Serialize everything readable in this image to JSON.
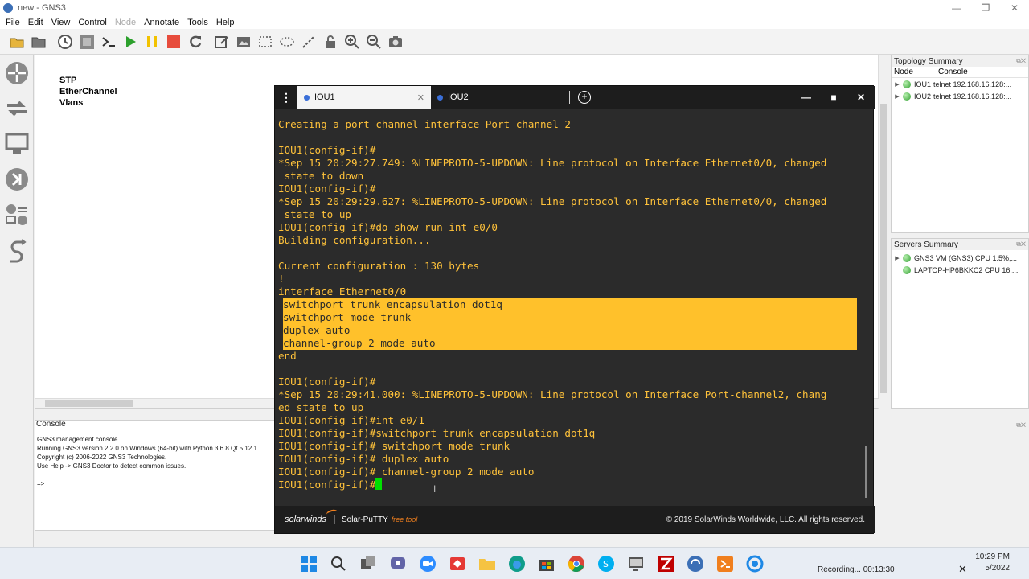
{
  "window": {
    "title": "new - GNS3",
    "controls": [
      "—",
      "❐",
      "✕"
    ]
  },
  "menu": {
    "items": [
      {
        "label": "File",
        "enabled": true
      },
      {
        "label": "Edit",
        "enabled": true
      },
      {
        "label": "View",
        "enabled": true
      },
      {
        "label": "Control",
        "enabled": true
      },
      {
        "label": "Node",
        "enabled": false
      },
      {
        "label": "Annotate",
        "enabled": true
      },
      {
        "label": "Tools",
        "enabled": true
      },
      {
        "label": "Help",
        "enabled": true
      }
    ]
  },
  "toolbar": {
    "icons": [
      "open-folder-icon",
      "folder-icon",
      "clock-icon",
      "snapshot-icon",
      "console-icon",
      "start-icon",
      "suspend-icon",
      "stop-icon",
      "reload-icon",
      "edit-note-icon",
      "insert-picture-icon",
      "rectangle-icon",
      "ellipse-icon",
      "line-icon",
      "lock-icon",
      "zoom-in-icon",
      "zoom-out-icon",
      "screenshot-icon"
    ],
    "colors": {
      "start": "#2ca02c",
      "suspend": "#f2c200",
      "stop": "#e74c3c"
    }
  },
  "canvas": {
    "note_lines": [
      "STP",
      "EtherChannel",
      "Vlans"
    ]
  },
  "topology_summary": {
    "title": "Topology Summary",
    "columns": [
      "Node",
      "Console"
    ],
    "rows": [
      {
        "node": "IOU1",
        "console": "telnet 192.168.16.128:..."
      },
      {
        "node": "IOU2",
        "console": "telnet 192.168.16.128:..."
      }
    ]
  },
  "servers_summary": {
    "title": "Servers Summary",
    "rows": [
      {
        "label": "GNS3 VM (GNS3) CPU 1.5%,..."
      },
      {
        "label": "LAPTOP-HP6BKKC2 CPU 16...."
      }
    ]
  },
  "console": {
    "title": "Console",
    "lines": [
      "GNS3 management console.",
      "Running GNS3 version 2.2.0 on Windows (64-bit) with Python 3.6.8 Qt 5.12.1",
      "Copyright (c) 2006-2022 GNS3 Technologies.",
      "Use Help -> GNS3 Doctor to detect common issues.",
      "",
      "=>"
    ]
  },
  "putty": {
    "tabs": [
      {
        "label": "IOU1",
        "active": true
      },
      {
        "label": "IOU2",
        "active": false
      }
    ],
    "terminal_lines": [
      {
        "text": "Creating a port-channel interface Port-channel 2",
        "hl": false
      },
      {
        "text": "",
        "hl": false
      },
      {
        "text": "IOU1(config-if)#",
        "hl": false
      },
      {
        "text": "*Sep 15 20:29:27.749: %LINEPROTO-5-UPDOWN: Line protocol on Interface Ethernet0/0, changed",
        "hl": false
      },
      {
        "text": " state to down",
        "hl": false
      },
      {
        "text": "IOU1(config-if)#",
        "hl": false
      },
      {
        "text": "*Sep 15 20:29:29.627: %LINEPROTO-5-UPDOWN: Line protocol on Interface Ethernet0/0, changed",
        "hl": false
      },
      {
        "text": " state to up",
        "hl": false
      },
      {
        "text": "IOU1(config-if)#do show run int e0/0",
        "hl": false
      },
      {
        "text": "Building configuration...",
        "hl": false
      },
      {
        "text": "",
        "hl": false
      },
      {
        "text": "Current configuration : 130 bytes",
        "hl": false
      },
      {
        "text": "!",
        "hl": false
      },
      {
        "text": "interface Ethernet0/0",
        "hl": false
      },
      {
        "text": "switchport trunk encapsulation dot1q",
        "hl": true
      },
      {
        "text": "switchport mode trunk",
        "hl": true
      },
      {
        "text": "duplex auto",
        "hl": true
      },
      {
        "text": "channel-group 2 mode auto",
        "hl": true
      },
      {
        "text": "end",
        "hl": false
      },
      {
        "text": "",
        "hl": false
      },
      {
        "text": "IOU1(config-if)#",
        "hl": false
      },
      {
        "text": "*Sep 15 20:29:41.000: %LINEPROTO-5-UPDOWN: Line protocol on Interface Port-channel2, chang",
        "hl": false
      },
      {
        "text": "ed state to up",
        "hl": false
      },
      {
        "text": "IOU1(config-if)#int e0/1",
        "hl": false
      },
      {
        "text": "IOU1(config-if)#switchport trunk encapsulation dot1q",
        "hl": false
      },
      {
        "text": "IOU1(config-if)# switchport mode trunk",
        "hl": false
      },
      {
        "text": "IOU1(config-if)# duplex auto",
        "hl": false
      },
      {
        "text": "IOU1(config-if)# channel-group 2 mode auto",
        "hl": false
      }
    ],
    "prompt": "IOU1(config-if)#",
    "footer": {
      "logo": "solarwinds",
      "product": "Solar-PuTTY",
      "product_tag": "free tool",
      "copyright": "© 2019 SolarWinds Worldwide, LLC. All rights reserved."
    },
    "colors": {
      "text": "#ffc23a",
      "highlight": "#ffc12b",
      "cursor": "#00e000",
      "background": "#2b2b2b"
    }
  },
  "taskbar": {
    "recording": "Recording... 00:13:30",
    "time": "10:29 PM",
    "date": "5/2022"
  }
}
